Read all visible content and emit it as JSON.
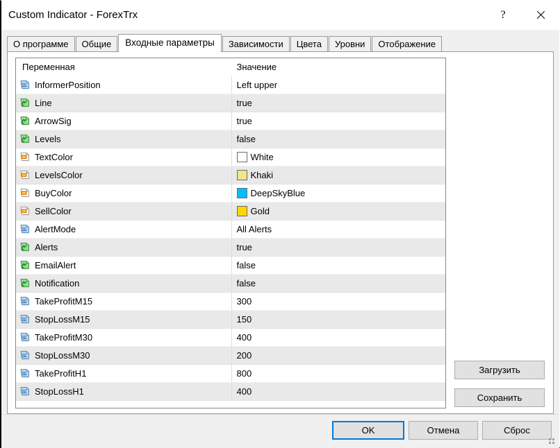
{
  "window": {
    "title": "Custom Indicator - ForexTrx",
    "help_glyph": "?",
    "close_glyph": "×"
  },
  "tabs": [
    {
      "label": "О программе",
      "active": false
    },
    {
      "label": "Общие",
      "active": false
    },
    {
      "label": "Входные параметры",
      "active": true
    },
    {
      "label": "Зависимости",
      "active": false
    },
    {
      "label": "Цвета",
      "active": false
    },
    {
      "label": "Уровни",
      "active": false
    },
    {
      "label": "Отображение",
      "active": false
    }
  ],
  "table": {
    "headers": {
      "variable": "Переменная",
      "value": "Значение"
    },
    "rows": [
      {
        "icon": "number-123-icon",
        "name": "InformerPosition",
        "value": "Left upper",
        "swatch": null
      },
      {
        "icon": "bool-graph-icon",
        "name": "Line",
        "value": "true",
        "swatch": null
      },
      {
        "icon": "bool-graph-icon",
        "name": "ArrowSig",
        "value": "true",
        "swatch": null
      },
      {
        "icon": "bool-graph-icon",
        "name": "Levels",
        "value": "false",
        "swatch": null
      },
      {
        "icon": "color-swatch-icon",
        "name": "TextColor",
        "value": "White",
        "swatch": "#FFFFFF"
      },
      {
        "icon": "color-swatch-icon",
        "name": "LevelsColor",
        "value": "Khaki",
        "swatch": "#F0E68C"
      },
      {
        "icon": "color-swatch-icon",
        "name": "BuyColor",
        "value": "DeepSkyBlue",
        "swatch": "#00BFFF"
      },
      {
        "icon": "color-swatch-icon",
        "name": "SellColor",
        "value": "Gold",
        "swatch": "#FFD700"
      },
      {
        "icon": "number-123-icon",
        "name": "AlertMode",
        "value": "All Alerts",
        "swatch": null
      },
      {
        "icon": "bool-graph-icon",
        "name": "Alerts",
        "value": "true",
        "swatch": null
      },
      {
        "icon": "bool-graph-icon",
        "name": "EmailAlert",
        "value": "false",
        "swatch": null
      },
      {
        "icon": "bool-graph-icon",
        "name": "Notification",
        "value": "false",
        "swatch": null
      },
      {
        "icon": "number-123-icon",
        "name": "TakeProfitM15",
        "value": "300",
        "swatch": null
      },
      {
        "icon": "number-123-icon",
        "name": "StopLossM15",
        "value": "150",
        "swatch": null
      },
      {
        "icon": "number-123-icon",
        "name": "TakeProfitM30",
        "value": "400",
        "swatch": null
      },
      {
        "icon": "number-123-icon",
        "name": "StopLossM30",
        "value": "200",
        "swatch": null
      },
      {
        "icon": "number-123-icon",
        "name": "TakeProfitH1",
        "value": "800",
        "swatch": null
      },
      {
        "icon": "number-123-icon",
        "name": "StopLossH1",
        "value": "400",
        "swatch": null
      }
    ]
  },
  "side_buttons": {
    "load": "Загрузить",
    "save": "Сохранить"
  },
  "footer_buttons": {
    "ok": "OK",
    "cancel": "Отмена",
    "reset": "Сброс"
  },
  "colors": {
    "accent": "#0078D7",
    "row_alt": "#E9E9E9",
    "dialog_bg": "#F0F0F0"
  }
}
